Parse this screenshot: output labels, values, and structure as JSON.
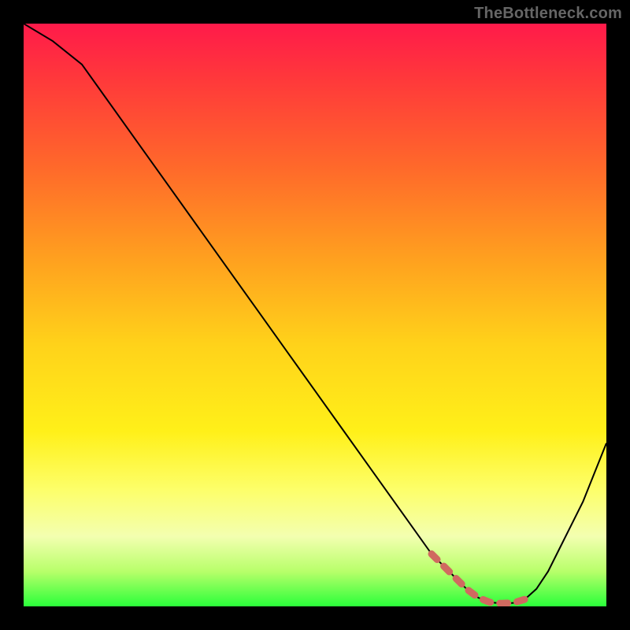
{
  "watermark": "TheBottleneck.com",
  "colors": {
    "background": "#000000",
    "gradient_top": "#ff1a4a",
    "gradient_bottom": "#2aff3a",
    "curve": "#000000",
    "highlight_dash": "#d06a60"
  },
  "chart_data": {
    "type": "line",
    "title": "",
    "xlabel": "",
    "ylabel": "",
    "xlim": [
      0,
      100
    ],
    "ylim": [
      0,
      100
    ],
    "x": [
      0,
      5,
      10,
      15,
      20,
      25,
      30,
      35,
      40,
      45,
      50,
      55,
      60,
      65,
      70,
      72,
      74,
      76,
      78,
      80,
      82,
      84,
      86,
      88,
      90,
      92,
      94,
      96,
      98,
      100
    ],
    "values": [
      100,
      97,
      93,
      86,
      79,
      72,
      65,
      58,
      51,
      44,
      37,
      30,
      23,
      16,
      9,
      7,
      5,
      3,
      1.5,
      0.7,
      0.5,
      0.6,
      1.2,
      3,
      6,
      10,
      14,
      18,
      23,
      28
    ],
    "annotations": [
      {
        "kind": "dashed_segment",
        "x_range": [
          70,
          86
        ],
        "y_approx": [
          9,
          1.2
        ],
        "note": "highlighted low-bottleneck region"
      }
    ]
  }
}
